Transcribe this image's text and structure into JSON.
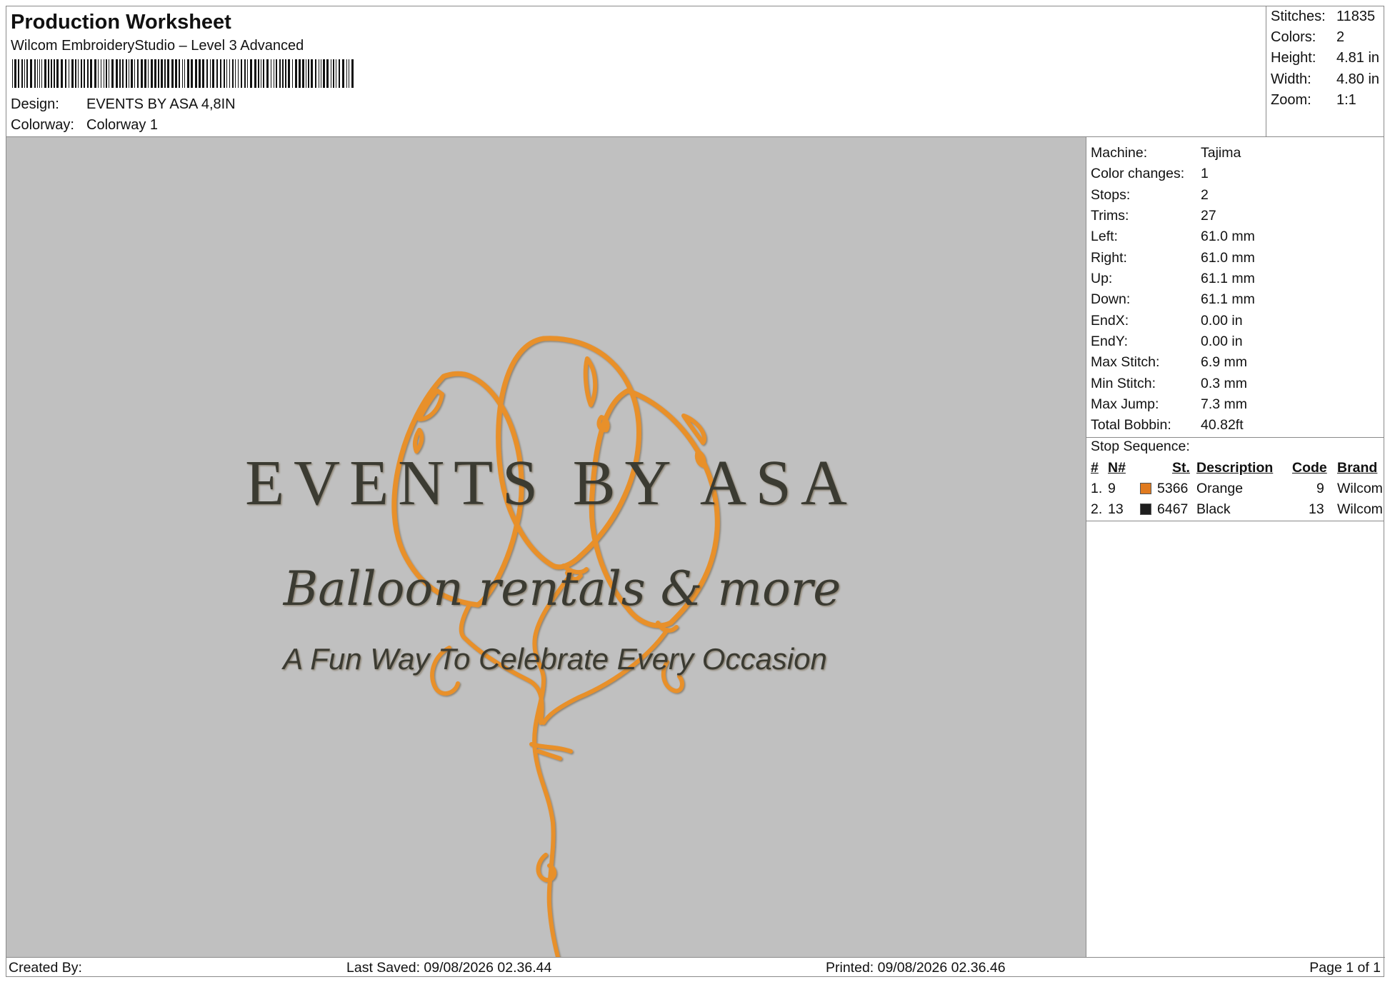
{
  "header": {
    "title": "Production Worksheet",
    "software": "Wilcom EmbroideryStudio – Level 3 Advanced",
    "design_label": "Design:",
    "design_value": "EVENTS BY ASA 4,8IN",
    "colorway_label": "Colorway:",
    "colorway_value": "Colorway 1"
  },
  "stats": [
    {
      "label": "Stitches:",
      "value": "11835"
    },
    {
      "label": "Colors:",
      "value": "2"
    },
    {
      "label": "Height:",
      "value": "4.81 in"
    },
    {
      "label": "Width:",
      "value": "4.80 in"
    },
    {
      "label": "Zoom:",
      "value": "1:1"
    }
  ],
  "design": {
    "line1": "EVENTS BY ASA",
    "line2": "Balloon rentals & more",
    "line3": "A Fun Way To Celebrate Every Occasion",
    "thread_orange": "#e8902a",
    "thread_black": "#3b3a33",
    "background": "#c0c0c0"
  },
  "machine_info": [
    {
      "label": "Machine:",
      "value": "Tajima"
    },
    {
      "label": "Color changes:",
      "value": "1"
    },
    {
      "label": "Stops:",
      "value": "2"
    },
    {
      "label": "Trims:",
      "value": "27"
    },
    {
      "label": "Left:",
      "value": "61.0 mm"
    },
    {
      "label": "Right:",
      "value": "61.0 mm"
    },
    {
      "label": "Up:",
      "value": "61.1 mm"
    },
    {
      "label": "Down:",
      "value": "61.1 mm"
    },
    {
      "label": "EndX:",
      "value": "0.00 in"
    },
    {
      "label": "EndY:",
      "value": "0.00 in"
    },
    {
      "label": "Max Stitch:",
      "value": "6.9 mm"
    },
    {
      "label": "Min Stitch:",
      "value": "0.3 mm"
    },
    {
      "label": "Max Jump:",
      "value": "7.3 mm"
    },
    {
      "label": "Total Bobbin:",
      "value": "40.82ft"
    }
  ],
  "stop_sequence": {
    "title": "Stop Sequence:",
    "headers": {
      "num": "#",
      "n": "N#",
      "st": "St.",
      "description": "Description",
      "code": "Code",
      "brand": "Brand"
    },
    "rows": [
      {
        "num": "1.",
        "n": "9",
        "color": "#e07a1f",
        "st": "5366",
        "description": "Orange",
        "code": "9",
        "brand": "Wilcom"
      },
      {
        "num": "2.",
        "n": "13",
        "color": "#1e1e1e",
        "st": "6467",
        "description": "Black",
        "code": "13",
        "brand": "Wilcom"
      }
    ]
  },
  "footer": {
    "created_by": "Created By:",
    "last_saved": "Last Saved: 09/08/2026 02.36.44",
    "printed": "Printed: 09/08/2026 02.36.46",
    "page": "Page 1 of 1"
  }
}
